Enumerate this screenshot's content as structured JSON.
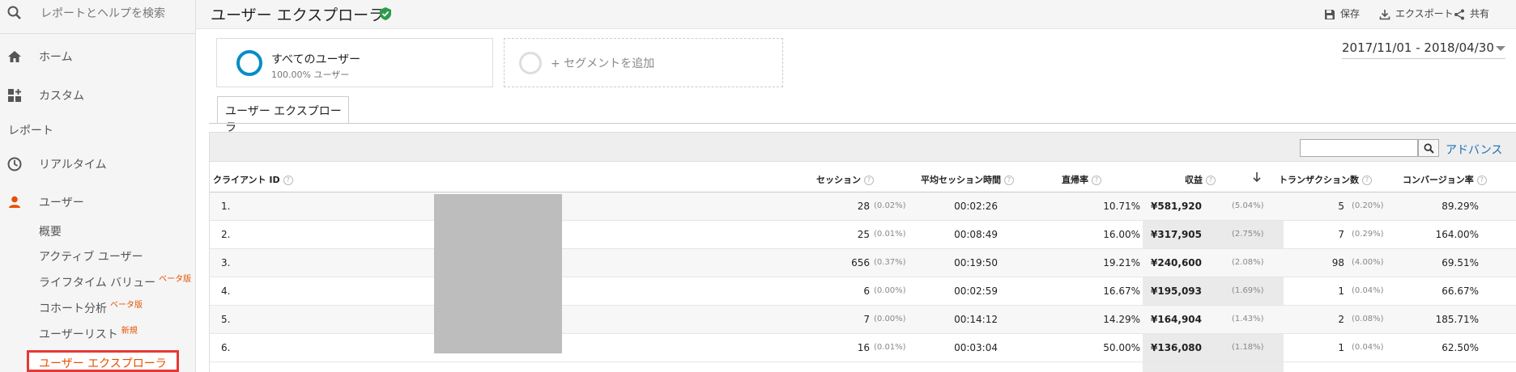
{
  "sidebar": {
    "search_label": "レポートとヘルプを検索",
    "home_label": "ホーム",
    "custom_label": "カスタム",
    "section_label": "レポート",
    "realtime_label": "リアルタイム",
    "user_label": "ユーザー",
    "subitems": [
      {
        "label": "概要",
        "tag": ""
      },
      {
        "label": "アクティブ ユーザー",
        "tag": ""
      },
      {
        "label": "ライフタイム バリュー",
        "tag": "ベータ版"
      },
      {
        "label": "コホート分析",
        "tag": "ベータ版"
      },
      {
        "label": "ユーザーリスト",
        "tag": "新規"
      }
    ],
    "active_label": "ユーザー エクスプローラ",
    "accent_color": "#e65100",
    "highlight_color": "#e53935"
  },
  "header": {
    "title": "ユーザー エクスプローラ",
    "actions": {
      "save": "保存",
      "export": "エクスポート",
      "share": "共有"
    }
  },
  "segments": {
    "primary_name": "すべてのユーザー",
    "primary_sub": "100.00% ユーザー",
    "add_label": "+ セグメントを追加",
    "primary_color": "#058dc7"
  },
  "date_range": "2017/11/01 - 2018/04/30",
  "tab_label": "ユーザー エクスプローラ",
  "filter": {
    "value": "",
    "advanced_label": "アドバンス"
  },
  "columns": {
    "client_id": "クライアント ID",
    "sessions": "セッション",
    "avg_duration": "平均セッション時間",
    "bounce_rate": "直帰率",
    "revenue": "収益",
    "transactions": "トランザクション数",
    "conversion_rate": "コンバージョン率"
  },
  "rows": [
    {
      "num": "1.",
      "sessions": "28",
      "sessions_pct": "(0.02%)",
      "duration": "00:02:26",
      "bounce": "10.71%",
      "revenue": "¥581,920",
      "revenue_pct": "(5.04%)",
      "tx": "5",
      "tx_pct": "(0.20%)",
      "conv": "89.29%"
    },
    {
      "num": "2.",
      "sessions": "25",
      "sessions_pct": "(0.01%)",
      "duration": "00:08:49",
      "bounce": "16.00%",
      "revenue": "¥317,905",
      "revenue_pct": "(2.75%)",
      "tx": "7",
      "tx_pct": "(0.29%)",
      "conv": "164.00%"
    },
    {
      "num": "3.",
      "sessions": "656",
      "sessions_pct": "(0.37%)",
      "duration": "00:19:50",
      "bounce": "19.21%",
      "revenue": "¥240,600",
      "revenue_pct": "(2.08%)",
      "tx": "98",
      "tx_pct": "(4.00%)",
      "conv": "69.51%"
    },
    {
      "num": "4.",
      "sessions": "6",
      "sessions_pct": "(0.00%)",
      "duration": "00:02:59",
      "bounce": "16.67%",
      "revenue": "¥195,093",
      "revenue_pct": "(1.69%)",
      "tx": "1",
      "tx_pct": "(0.04%)",
      "conv": "66.67%"
    },
    {
      "num": "5.",
      "sessions": "7",
      "sessions_pct": "(0.00%)",
      "duration": "00:14:12",
      "bounce": "14.29%",
      "revenue": "¥164,904",
      "revenue_pct": "(1.43%)",
      "tx": "2",
      "tx_pct": "(0.08%)",
      "conv": "185.71%"
    },
    {
      "num": "6.",
      "sessions": "16",
      "sessions_pct": "(0.01%)",
      "duration": "00:03:04",
      "bounce": "50.00%",
      "revenue": "¥136,080",
      "revenue_pct": "(1.18%)",
      "tx": "1",
      "tx_pct": "(0.04%)",
      "conv": "62.50%"
    }
  ]
}
